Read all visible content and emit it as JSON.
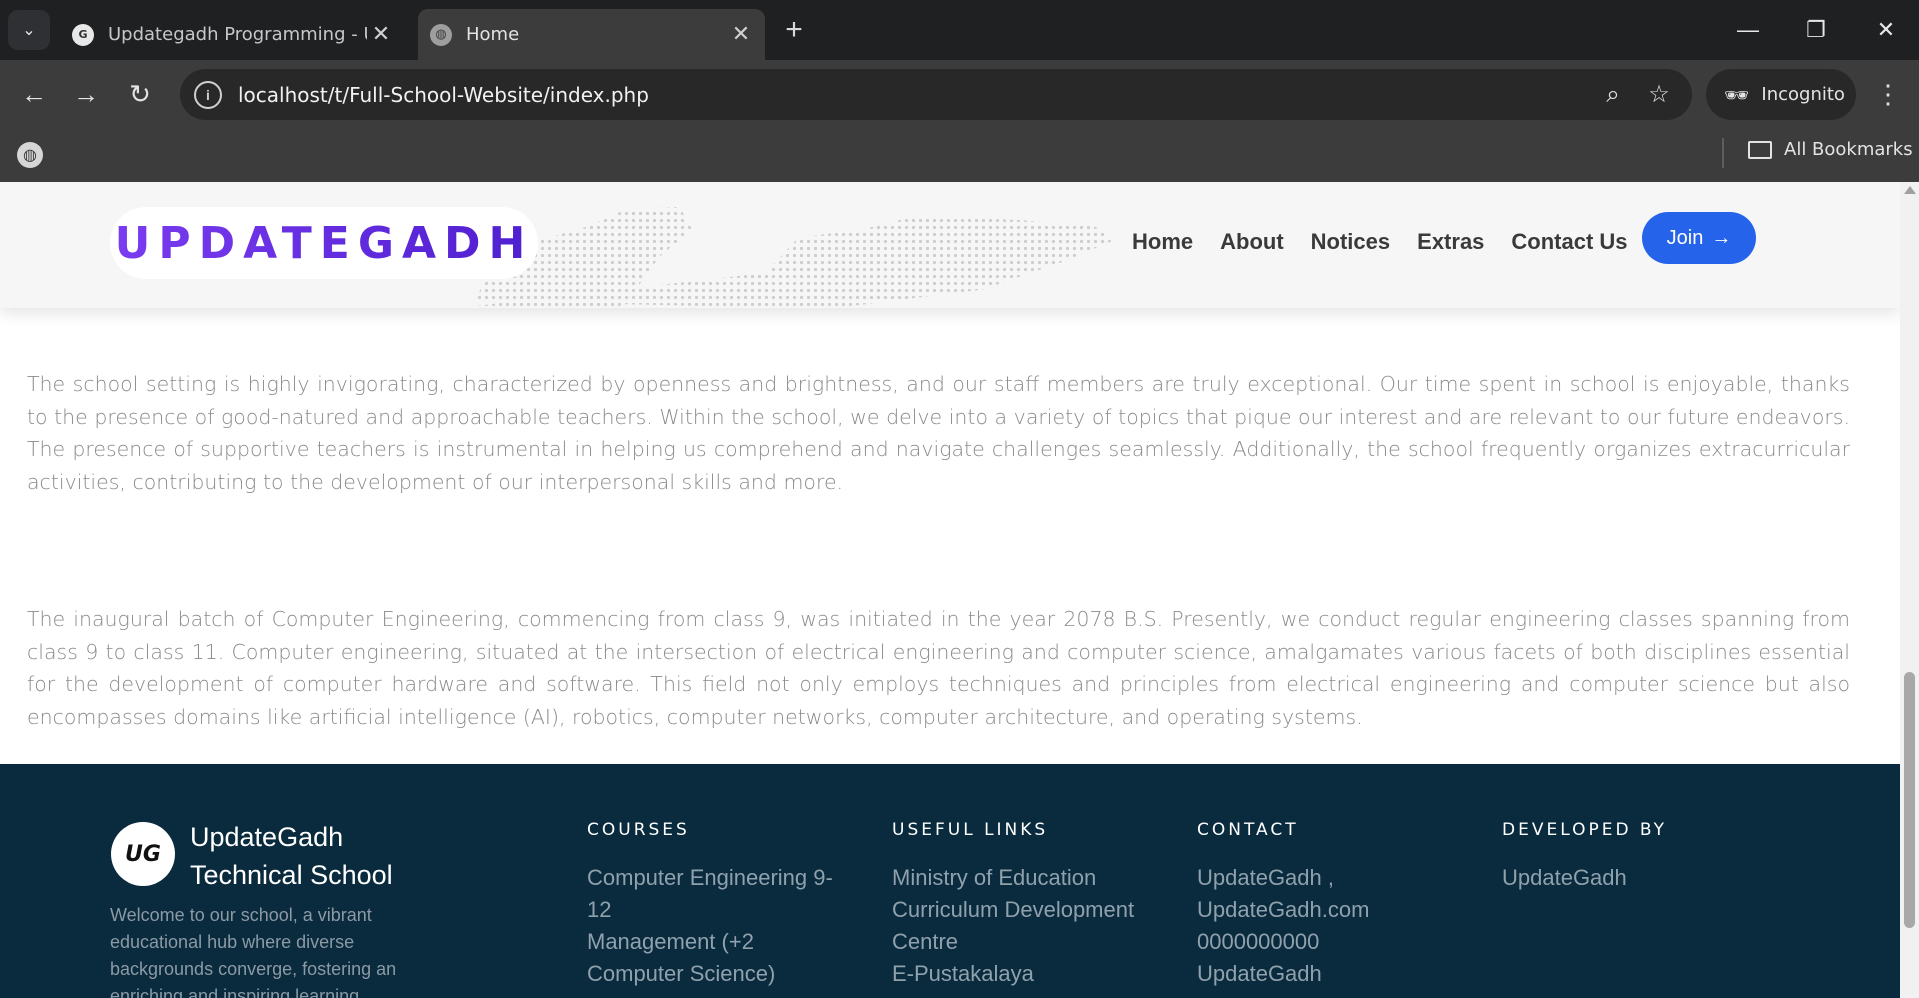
{
  "browser": {
    "tabs": [
      {
        "title": "Updategadh Programming - Up",
        "active": false
      },
      {
        "title": "Home",
        "active": true
      }
    ],
    "url": "localhost/t/Full-School-Website/index.php",
    "incognito_label": "Incognito",
    "bookmarks_label": "All Bookmarks"
  },
  "header": {
    "logo": "UPDATEGADH",
    "nav": [
      "Home",
      "About",
      "Notices",
      "Extras",
      "Contact Us"
    ],
    "join_label": "Join"
  },
  "content": {
    "paragraph_1": "The school setting is highly invigorating, characterized by openness and brightness, and our staff members are truly exceptional. Our time spent in school is enjoyable, thanks to the presence of good-natured and approachable teachers. Within the school, we delve into a variety of topics that pique our interest and are relevant to our future endeavors. The presence of supportive teachers is instrumental in helping us comprehend and navigate challenges seamlessly. Additionally, the school frequently organizes extracurricular activities, contributing to the development of our interpersonal skills and more.",
    "paragraph_2": "The inaugural batch of Computer Engineering, commencing from class 9, was initiated in the year 2078 B.S. Presently, we conduct regular engineering classes spanning from class 9 to class 11. Computer engineering, situated at the intersection of electrical engineering and computer science, amalgamates various facets of both disciplines essential for the development of computer hardware and software. This field not only employs techniques and principles from electrical engineering and computer science but also encompasses domains like artificial intelligence (AI), robotics, computer networks, computer architecture, and operating systems."
  },
  "footer": {
    "logo_text": "UG",
    "school_name_line1": "UpdateGadh",
    "school_name_line2": "Technical School",
    "description": "Welcome to our school, a vibrant educational hub where diverse backgrounds converge, fostering an enriching and inspiring learning",
    "courses": {
      "heading": "COURSES",
      "items": [
        "Computer Engineering 9-12",
        "Management (+2 Computer Science)"
      ]
    },
    "useful_links": {
      "heading": "USEFUL LINKS",
      "items": [
        "Ministry of Education",
        "Curriculum Development Centre",
        "E-Pustakalaya"
      ]
    },
    "contact": {
      "heading": "CONTACT",
      "items": [
        "UpdateGadh ,",
        "UpdateGadh.com",
        "0000000000",
        "UpdateGadh"
      ]
    },
    "developed_by": {
      "heading": "DEVELOPED BY",
      "items": [
        "UpdateGadh"
      ]
    }
  },
  "colors": {
    "accent_blue": "#2563eb",
    "logo_purple": "#6a2fe0",
    "footer_bg": "#0a2a3d"
  }
}
